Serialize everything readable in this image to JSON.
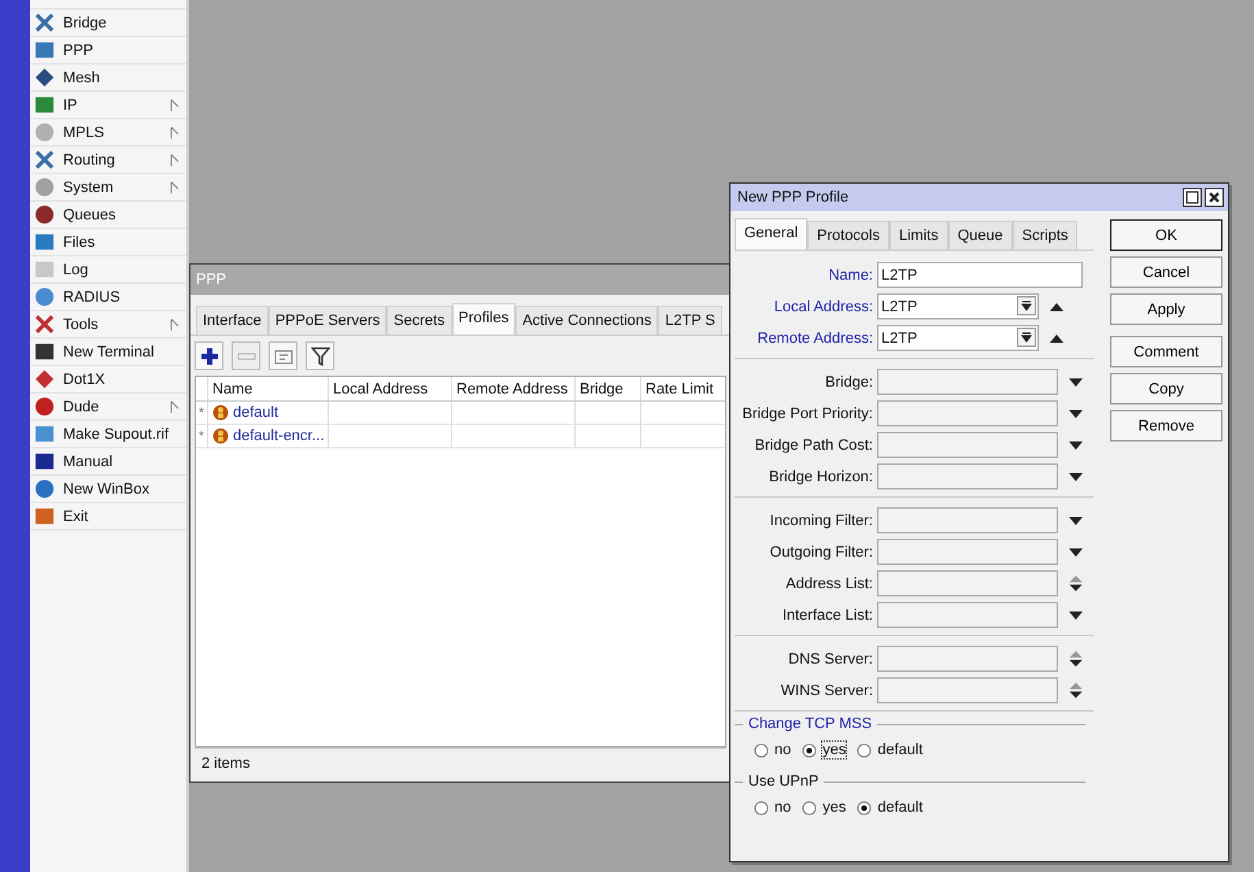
{
  "sidebar": {
    "items": [
      {
        "label": "Bridge",
        "submenu": false
      },
      {
        "label": "PPP",
        "submenu": false
      },
      {
        "label": "Mesh",
        "submenu": false
      },
      {
        "label": "IP",
        "submenu": true
      },
      {
        "label": "MPLS",
        "submenu": true
      },
      {
        "label": "Routing",
        "submenu": true
      },
      {
        "label": "System",
        "submenu": true
      },
      {
        "label": "Queues",
        "submenu": false
      },
      {
        "label": "Files",
        "submenu": false
      },
      {
        "label": "Log",
        "submenu": false
      },
      {
        "label": "RADIUS",
        "submenu": false
      },
      {
        "label": "Tools",
        "submenu": true
      },
      {
        "label": "New Terminal",
        "submenu": false
      },
      {
        "label": "Dot1X",
        "submenu": false
      },
      {
        "label": "Dude",
        "submenu": true
      },
      {
        "label": "Make Supout.rif",
        "submenu": false
      },
      {
        "label": "Manual",
        "submenu": false
      },
      {
        "label": "New WinBox",
        "submenu": false
      },
      {
        "label": "Exit",
        "submenu": false
      }
    ]
  },
  "ppp_window": {
    "title": "PPP",
    "tabs": [
      {
        "label": "Interface",
        "selected": false
      },
      {
        "label": "PPPoE Servers",
        "selected": false
      },
      {
        "label": "Secrets",
        "selected": false
      },
      {
        "label": "Profiles",
        "selected": true
      },
      {
        "label": "Active Connections",
        "selected": false
      },
      {
        "label": "L2TP S",
        "selected": false
      }
    ],
    "toolbar": [
      {
        "kind": "add",
        "disabled": false
      },
      {
        "kind": "remove",
        "disabled": true
      },
      {
        "kind": "comment",
        "disabled": false
      },
      {
        "kind": "filter",
        "disabled": false
      }
    ],
    "columns": [
      "Name",
      "Local Address",
      "Remote Address",
      "Bridge",
      "Rate Limit"
    ],
    "rows": [
      {
        "flag": "*",
        "name": "default"
      },
      {
        "flag": "*",
        "name": "default-encr..."
      }
    ],
    "status_bar": "2 items"
  },
  "dialog": {
    "title": "New PPP Profile",
    "tabs": [
      {
        "label": "General",
        "selected": true
      },
      {
        "label": "Protocols",
        "selected": false
      },
      {
        "label": "Limits",
        "selected": false
      },
      {
        "label": "Queue",
        "selected": false
      },
      {
        "label": "Scripts",
        "selected": false
      }
    ],
    "field_groups": [
      [
        {
          "label": "Name:",
          "kind": "text",
          "value": "L2TP",
          "highlighted": true
        },
        {
          "label": "Local Address:",
          "kind": "combo",
          "value": "L2TP",
          "highlighted": true
        },
        {
          "label": "Remote Address:",
          "kind": "combo",
          "value": "L2TP",
          "highlighted": true
        }
      ],
      [
        {
          "label": "Bridge:",
          "kind": "dropdown",
          "highlighted": false
        },
        {
          "label": "Bridge Port Priority:",
          "kind": "dropdown",
          "highlighted": false
        },
        {
          "label": "Bridge Path Cost:",
          "kind": "dropdown",
          "highlighted": false
        },
        {
          "label": "Bridge Horizon:",
          "kind": "dropdown",
          "highlighted": false
        }
      ],
      [
        {
          "label": "Incoming Filter:",
          "kind": "dropdown",
          "highlighted": false
        },
        {
          "label": "Outgoing Filter:",
          "kind": "dropdown",
          "highlighted": false
        },
        {
          "label": "Address List:",
          "kind": "updown",
          "highlighted": false
        },
        {
          "label": "Interface List:",
          "kind": "dropdown",
          "highlighted": false
        }
      ],
      [
        {
          "label": "DNS Server:",
          "kind": "updown",
          "highlighted": false
        },
        {
          "label": "WINS Server:",
          "kind": "updown",
          "highlighted": false
        }
      ]
    ],
    "radio_groups": [
      {
        "title": "Change TCP MSS",
        "highlighted": true,
        "options": [
          {
            "label": "no",
            "selected": false,
            "focused": false
          },
          {
            "label": "yes",
            "selected": true,
            "focused": true
          },
          {
            "label": "default",
            "selected": false,
            "focused": false
          }
        ]
      },
      {
        "title": "Use UPnP",
        "highlighted": false,
        "options": [
          {
            "label": "no",
            "selected": false,
            "focused": false
          },
          {
            "label": "yes",
            "selected": false,
            "focused": false
          },
          {
            "label": "default",
            "selected": true,
            "focused": false
          }
        ]
      }
    ],
    "buttons": [
      {
        "label": "OK",
        "default": true
      },
      {
        "label": "Cancel",
        "default": false
      },
      {
        "label": "Apply",
        "default": false
      },
      {
        "label": "Comment",
        "default": false
      },
      {
        "label": "Copy",
        "default": false
      },
      {
        "label": "Remove",
        "default": false
      }
    ]
  }
}
